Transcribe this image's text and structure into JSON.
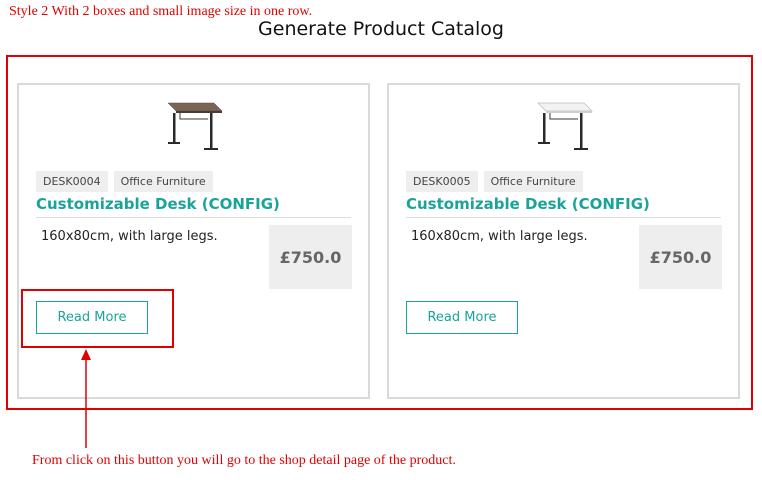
{
  "annotation_top": "Style 2 With 2 boxes and small image size in one row.",
  "page_title": "Generate Product Catalog",
  "products": [
    {
      "sku": "DESK0004",
      "category": "Office Furniture",
      "title": "Customizable Desk (CONFIG)",
      "description": "160x80cm, with large legs.",
      "price": "£750.0",
      "button_label": "Read More",
      "desk_top_color": "#7a6455"
    },
    {
      "sku": "DESK0005",
      "category": "Office Furniture",
      "title": "Customizable Desk (CONFIG)",
      "description": "160x80cm, with large legs.",
      "price": "£750.0",
      "button_label": "Read More",
      "desk_top_color": "#f2f2f2"
    }
  ],
  "annotation_bottom": "From click on this button you will go to the shop detail page of the product.",
  "colors": {
    "accent": "#1aa39a",
    "annotation": "#e00000"
  }
}
